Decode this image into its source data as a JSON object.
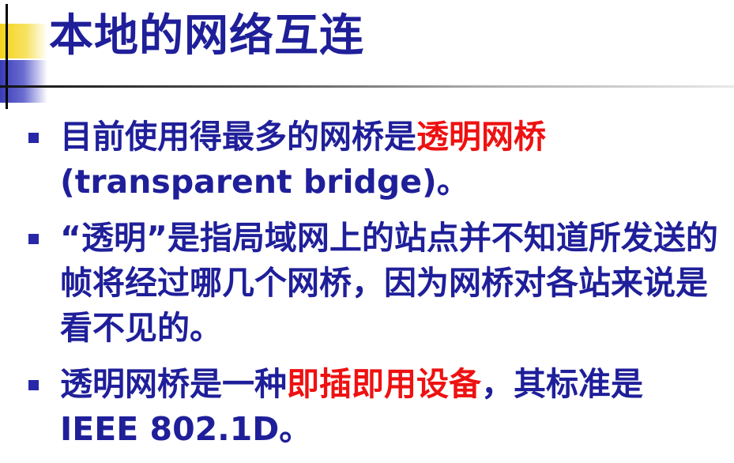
{
  "slide": {
    "title": "本地的网络互连",
    "bullets": [
      {
        "parts": [
          {
            "text": "目前使用得最多的网桥是",
            "highlight": false
          },
          {
            "text": "透明网桥",
            "highlight": true
          },
          {
            "text": "(transparent bridge)。",
            "highlight": false,
            "break_before": true
          }
        ]
      },
      {
        "parts": [
          {
            "text": "“透明”是指局域网上的站点并不知道所发送的帧将经过哪几个网桥，因为网桥对各站来说是看不见的。",
            "highlight": false
          }
        ]
      },
      {
        "parts": [
          {
            "text": "透明网桥是一种",
            "highlight": false
          },
          {
            "text": "即插即用设备",
            "highlight": true
          },
          {
            "text": "，其标准是 IEEE 802.1D。",
            "highlight": false
          }
        ]
      }
    ]
  },
  "colors": {
    "text": "#1f1f9a",
    "highlight": "#ee1111",
    "bullet": "#2727a8",
    "deco_yellow": "#f4d31c",
    "deco_blue": "#3a3cb8"
  }
}
